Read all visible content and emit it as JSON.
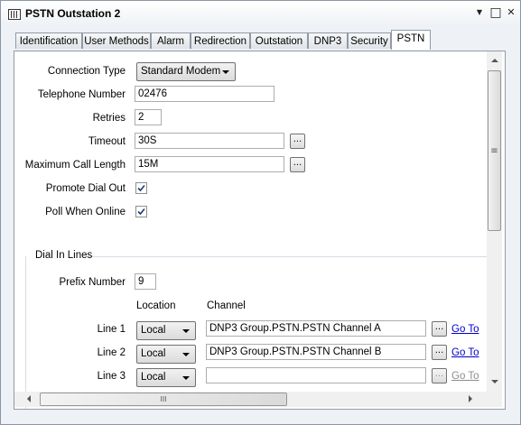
{
  "window": {
    "title": "PSTN Outstation 2"
  },
  "titlebar": {
    "dropdown_glyph": "▼",
    "restore_glyph": "□",
    "close_glyph": "✕"
  },
  "tabs": [
    {
      "label": "Identification"
    },
    {
      "label": "User Methods"
    },
    {
      "label": "Alarm"
    },
    {
      "label": "Redirection"
    },
    {
      "label": "Outstation"
    },
    {
      "label": "DNP3"
    },
    {
      "label": "Security"
    },
    {
      "label": "PSTN"
    }
  ],
  "active_tab": "PSTN",
  "form": {
    "connection_type": {
      "label": "Connection Type",
      "value": "Standard Modem"
    },
    "telephone_number": {
      "label": "Telephone Number",
      "value": "02476"
    },
    "retries": {
      "label": "Retries",
      "value": "2"
    },
    "timeout": {
      "label": "Timeout",
      "value": "30S"
    },
    "max_call_length": {
      "label": "Maximum Call Length",
      "value": "15M"
    },
    "promote_dial_out": {
      "label": "Promote Dial Out",
      "checked": true
    },
    "poll_when_online": {
      "label": "Poll When Online",
      "checked": true
    },
    "browse_label": "..."
  },
  "dial_in": {
    "group_title": "Dial In Lines",
    "prefix_number": {
      "label": "Prefix Number",
      "value": "9"
    },
    "location_header": "Location",
    "channel_header": "Channel",
    "goto_label": "Go To",
    "lines": [
      {
        "label": "Line 1",
        "location": "Local",
        "channel": "DNP3 Group.PSTN.PSTN Channel A",
        "goto_enabled": true
      },
      {
        "label": "Line 2",
        "location": "Local",
        "channel": "DNP3 Group.PSTN.PSTN Channel B",
        "goto_enabled": true
      },
      {
        "label": "Line 3",
        "location": "Local",
        "channel": "",
        "goto_enabled": false
      }
    ]
  },
  "scrollbar": {
    "h_grip": "III",
    "v_grip": "≡"
  }
}
